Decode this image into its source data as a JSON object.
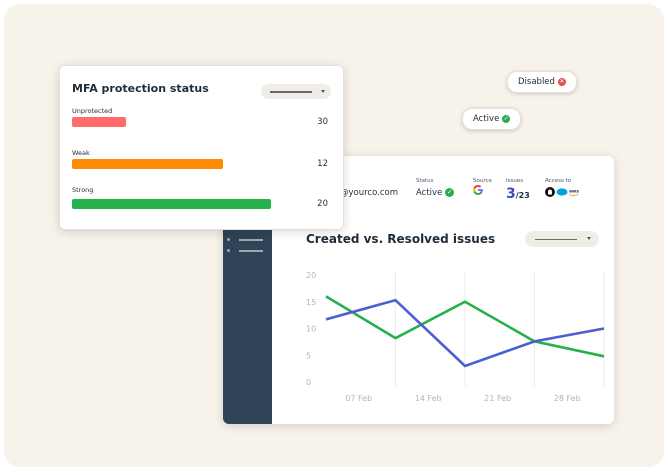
{
  "badges": {
    "disabled": "Disabled",
    "active": "Active"
  },
  "dashboard": {
    "email": "@yourco.com",
    "status_label": "Status",
    "status_value": "Active",
    "source_label": "Source",
    "source_icon": "google-icon",
    "issues_label": "Issues",
    "issues_count": "3",
    "issues_total": "/23",
    "access_label": "Access to",
    "access_icons": [
      "github-icon",
      "salesforce-icon",
      "aws-icon"
    ]
  },
  "mfa": {
    "title": "MFA protection status",
    "rows": [
      {
        "label": "Unprotected",
        "value": "30",
        "fraction": 0.27,
        "color": "#ff6b6b"
      },
      {
        "label": "Weak",
        "value": "12",
        "fraction": 0.76,
        "color": "#ff8c00"
      },
      {
        "label": "Strong",
        "value": "20",
        "fraction": 1.0,
        "color": "#26b04c"
      }
    ]
  },
  "chart_data": {
    "type": "line",
    "title": "Created vs. Resolved issues",
    "categories": [
      "07 Feb",
      "14 Feb",
      "21 Feb",
      "28 Feb"
    ],
    "x": [
      0,
      1,
      2,
      3,
      4
    ],
    "y_ticks": [
      "20",
      "15",
      "10",
      "5",
      "0"
    ],
    "ylim": [
      0,
      20
    ],
    "grid": "vertical",
    "series": [
      {
        "color": "#26b04c",
        "values": [
          16,
          8.2,
          15,
          7.6,
          4.8
        ]
      },
      {
        "color": "#4a5fd4",
        "values": [
          11.7,
          15.3,
          3,
          7.6,
          10
        ]
      }
    ]
  }
}
